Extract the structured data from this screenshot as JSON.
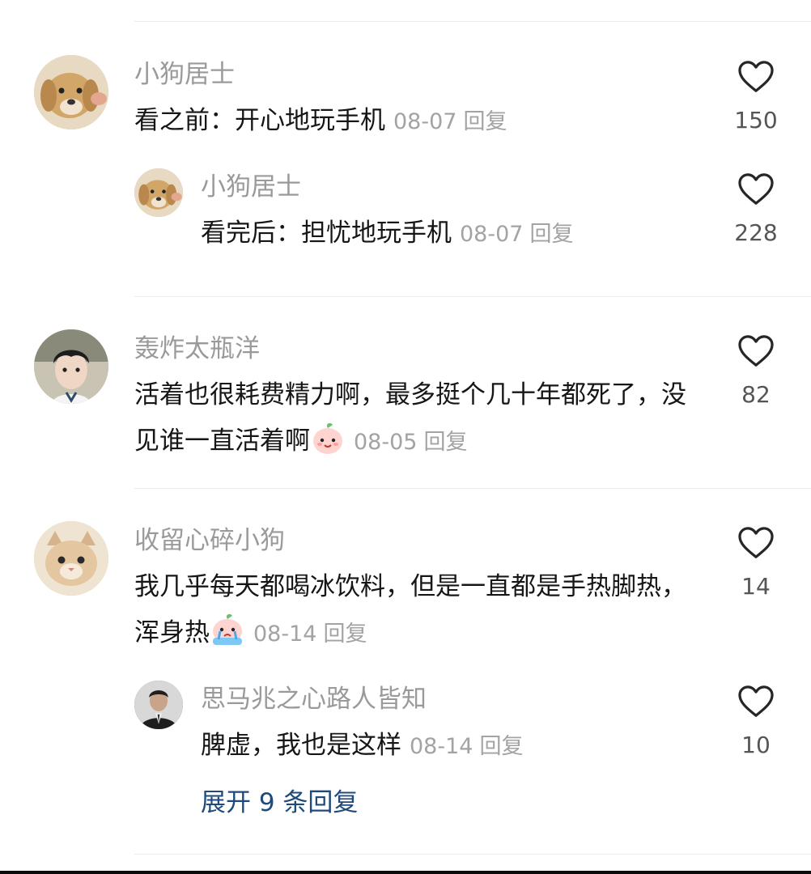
{
  "comments": [
    {
      "username": "小狗居士",
      "text": "看之前：开心地玩手机",
      "date": "08-07",
      "reply_label": "回复",
      "likes": "150",
      "avatar": "puppy-avatar",
      "replies": [
        {
          "username": "小狗居士",
          "text": "看完后：担忧地玩手机",
          "date": "08-07",
          "reply_label": "回复",
          "likes": "228",
          "avatar": "puppy-avatar"
        }
      ]
    },
    {
      "username": "轰炸太瓶洋",
      "text": "活着也很耗费精力啊，最多挺个几十年都死了，没见谁一直活着啊",
      "emoji": "smiling-peach-emoji",
      "date": "08-05",
      "reply_label": "回复",
      "likes": "82",
      "avatar": "boy-avatar"
    },
    {
      "username": "收留心碎小狗",
      "text": "我几乎每天都喝冰饮料，但是一直都是手热脚热，浑身热",
      "emoji": "crying-peach-emoji",
      "date": "08-14",
      "reply_label": "回复",
      "likes": "14",
      "avatar": "cat-avatar",
      "replies": [
        {
          "username": "思马兆之心路人皆知",
          "text": "脾虚，我也是这样",
          "date": "08-14",
          "reply_label": "回复",
          "likes": "10",
          "avatar": "man-in-suit-avatar"
        }
      ],
      "expand_label": "展开 9 条回复"
    }
  ]
}
